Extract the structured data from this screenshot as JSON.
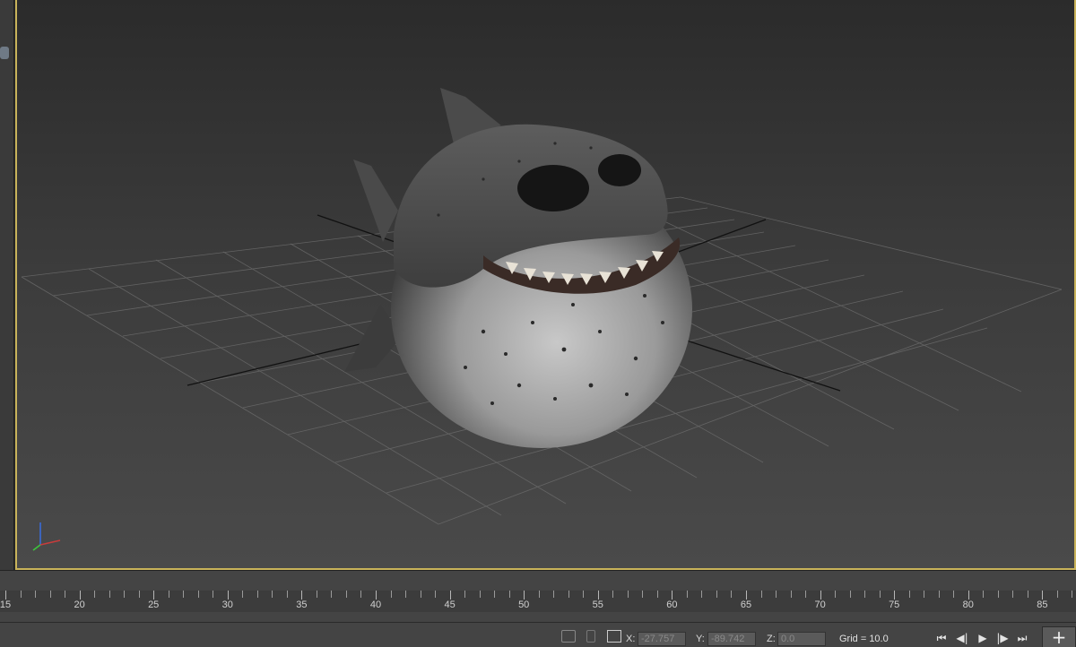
{
  "viewport": {
    "object_name": "shark",
    "active_border_color": "#c9b35a"
  },
  "timeline": {
    "ruler_labels": [
      "15",
      "20",
      "25",
      "30",
      "35",
      "40",
      "45",
      "50",
      "55",
      "60",
      "65",
      "70",
      "75",
      "80",
      "85"
    ]
  },
  "status_bar": {
    "x_label": "X:",
    "x_value": "-27.757",
    "y_label": "Y:",
    "y_value": "-89.742",
    "z_label": "Z:",
    "z_value": "0.0",
    "grid_text": "Grid = 10.0",
    "add_button_label": "+",
    "icons": [
      "isolate-selection-icon",
      "lock-selection-icon",
      "absolute-mode-transform-icon",
      "go-to-start-icon",
      "previous-frame-icon",
      "play-icon",
      "next-frame-icon",
      "go-to-end-icon"
    ]
  }
}
